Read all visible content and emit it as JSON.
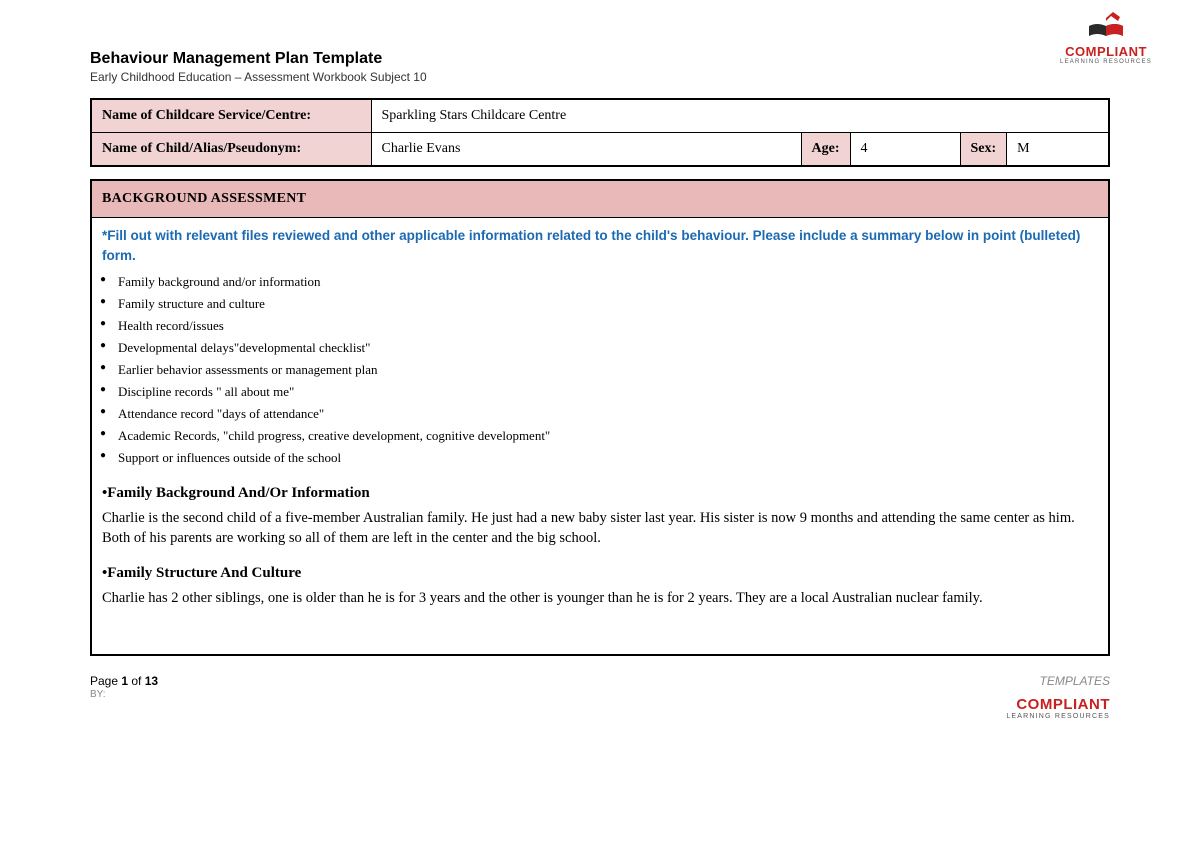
{
  "header": {
    "title": "Behaviour Management Plan Template",
    "subtitle": "Early Childhood Education – Assessment Workbook Subject 10",
    "brand": "COMPLIANT",
    "brand_sub": "LEARNING RESOURCES"
  },
  "info": {
    "service_label": "Name of Childcare Service/Centre:",
    "service_value": "Sparkling Stars Childcare Centre",
    "child_label": "Name of Child/Alias/Pseudonym:",
    "child_value": "Charlie Evans",
    "age_label": "Age:",
    "age_value": "4",
    "sex_label": "Sex:",
    "sex_value": "M"
  },
  "section": {
    "title": "BACKGROUND ASSESSMENT",
    "instruction": "*Fill out with relevant files reviewed and other applicable information related to the child's behaviour. Please include a summary below in point (bulleted) form.",
    "bullets": [
      "Family background and/or information",
      "Family structure and culture",
      "Health record/issues",
      "Developmental delays\"developmental checklist\"",
      "Earlier behavior assessments or management plan",
      "Discipline records \" all about me\"",
      "Attendance record \"days of attendance\"",
      "Academic Records, \"child progress, creative development, cognitive development\"",
      "Support or influences outside of the school"
    ],
    "h1": "•Family Background And/Or Information",
    "p1": "Charlie is the second child of a five-member Australian family. He just had a new baby sister last year. His sister is now 9 months and attending the same center as him. Both of his parents are working so all of them are left in the center and the big school.",
    "h2": "•Family Structure And Culture",
    "p2": "Charlie has 2 other siblings, one is older than he is for 3 years and the other is younger than he is for 2 years. They are a local Australian nuclear family."
  },
  "footer": {
    "page_prefix": "Page ",
    "page_current": "1",
    "page_of": " of ",
    "page_total": "13",
    "by": "BY:",
    "templates": "TEMPLATES"
  }
}
